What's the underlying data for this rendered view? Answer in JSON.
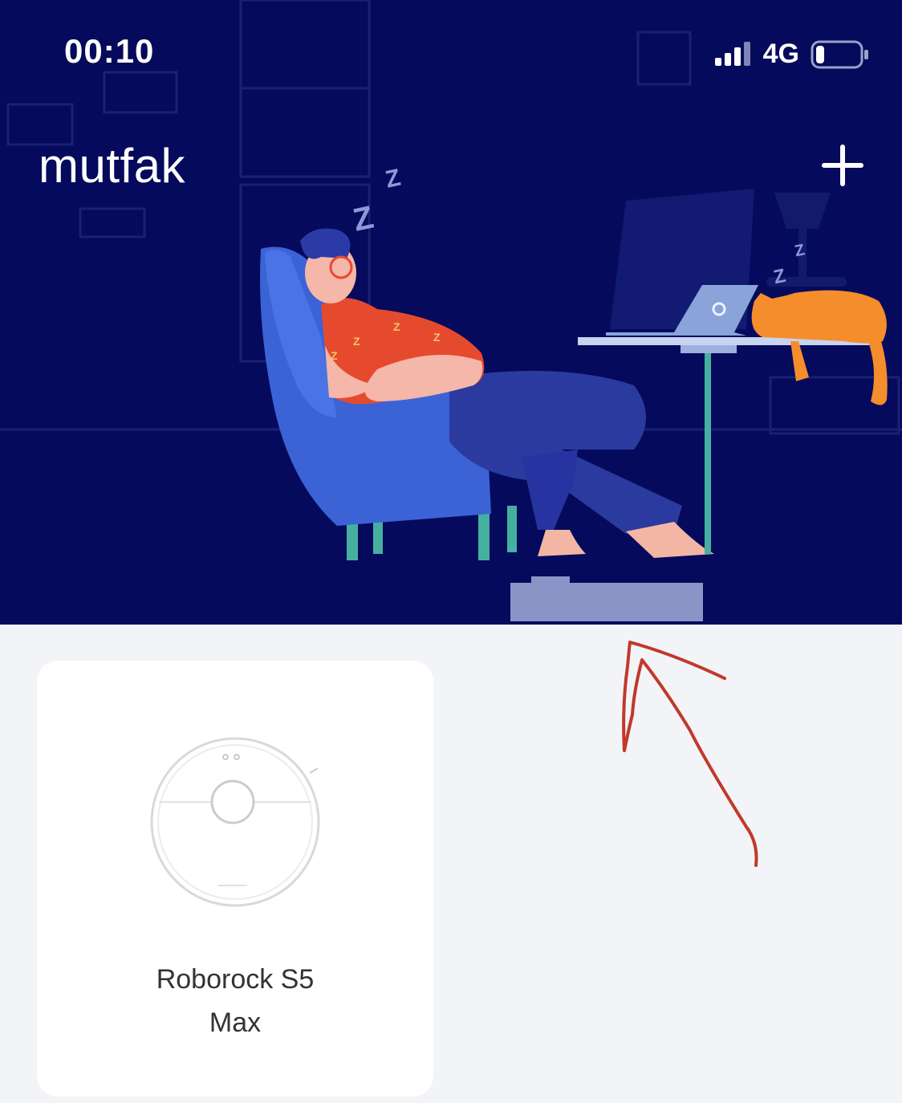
{
  "status_bar": {
    "time": "00:10",
    "network": "4G",
    "signal_icon": "cellular-signal-icon",
    "battery_icon": "battery-icon",
    "battery_level": 0.12
  },
  "header": {
    "room_name": "mutfak",
    "add_icon": "plus-icon"
  },
  "hero": {
    "illustration": "sleeping-person-illustration",
    "sleep_letters": [
      "Z",
      "Z",
      "Z",
      "Z"
    ]
  },
  "devices": [
    {
      "name": "Roborock S5 Max",
      "icon": "robot-vacuum-icon"
    }
  ],
  "annotation": {
    "arrow_icon": "hand-drawn-arrow-icon",
    "color": "#c0392b"
  },
  "colors": {
    "hero_background": "#050a5c",
    "page_background": "#f3f4f7",
    "card_background": "#ffffff"
  }
}
